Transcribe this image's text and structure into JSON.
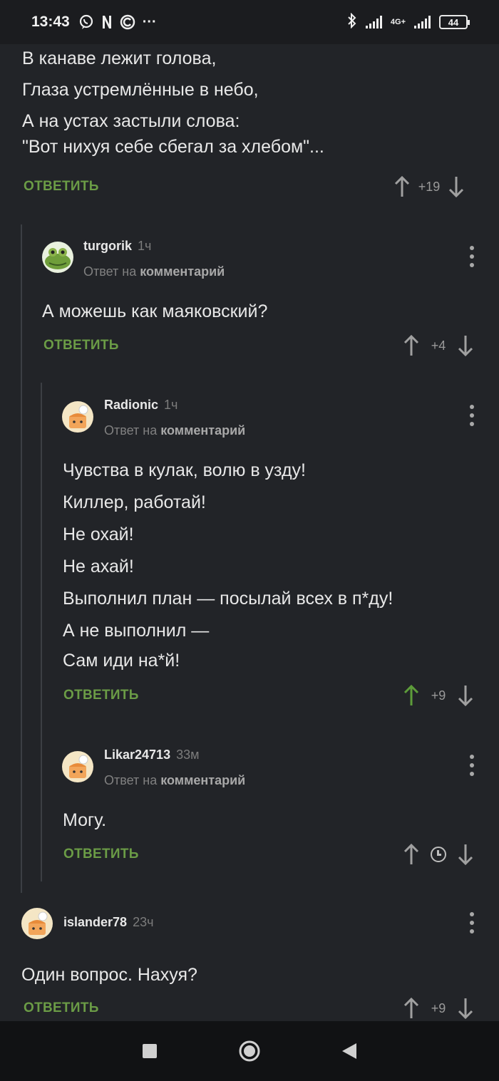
{
  "status_bar": {
    "time": "13:43",
    "icons": [
      "viber-icon",
      "n-icon",
      "c-icon",
      "more-icon"
    ],
    "more_glyph": "···",
    "network": "4G+",
    "battery": "44"
  },
  "reply_label": "ОТВЕТИТЬ",
  "reply_to": {
    "prefix": "Ответ на",
    "target": "комментарий"
  },
  "comments": [
    {
      "lines": [
        "В канаве лежит голова,",
        "Глаза устремлённые в небо,",
        "А на устах застыли слова:",
        "\"Вот нихуя себе сбегал за хлебом\"..."
      ],
      "score": "+19"
    },
    {
      "author": "turgorik",
      "time": "1ч",
      "lines": [
        "А можешь как маяковский?"
      ],
      "score": "+4"
    },
    {
      "author": "Radionic",
      "time": "1ч",
      "lines": [
        "Чувства в кулак, волю в узду!",
        "Киллер, работай!",
        "Не охай!",
        "Не ахай!",
        "Выполнил план — посылай всех в п*ду!",
        "А не выполнил —",
        "Сам иди на*й!"
      ],
      "score": "+9"
    },
    {
      "author": "Likar24713",
      "time": "33м",
      "lines": [
        "Могу."
      ],
      "score": ""
    },
    {
      "author": "islander78",
      "time": "23ч",
      "lines": [
        "Один вопрос. Нахуя?"
      ],
      "score": "+9"
    }
  ],
  "colors": {
    "background": "#222428",
    "accent_green": "#6b9c46",
    "upvoted_green": "#5d9c3a"
  }
}
